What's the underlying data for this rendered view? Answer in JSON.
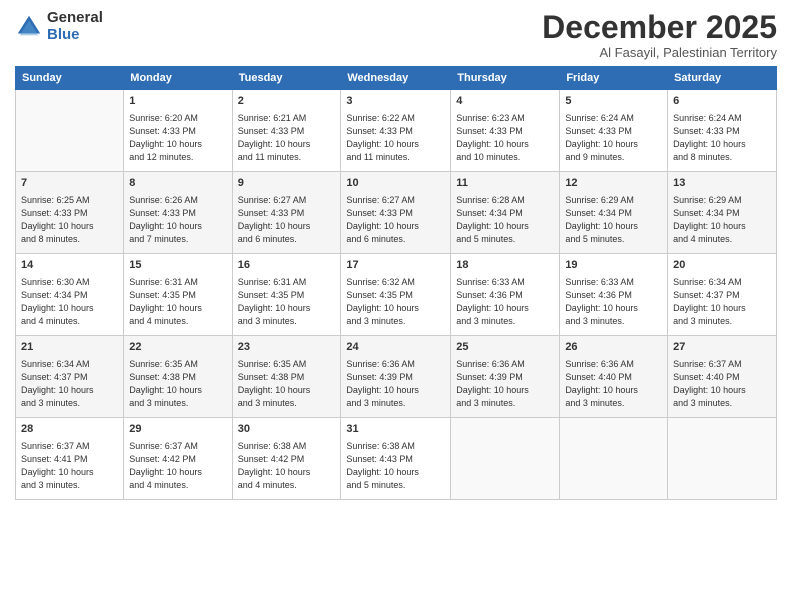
{
  "logo": {
    "general": "General",
    "blue": "Blue"
  },
  "header": {
    "month": "December 2025",
    "location": "Al Fasayil, Palestinian Territory"
  },
  "weekdays": [
    "Sunday",
    "Monday",
    "Tuesday",
    "Wednesday",
    "Thursday",
    "Friday",
    "Saturday"
  ],
  "weeks": [
    [
      {
        "day": "",
        "info": ""
      },
      {
        "day": "1",
        "info": "Sunrise: 6:20 AM\nSunset: 4:33 PM\nDaylight: 10 hours\nand 12 minutes."
      },
      {
        "day": "2",
        "info": "Sunrise: 6:21 AM\nSunset: 4:33 PM\nDaylight: 10 hours\nand 11 minutes."
      },
      {
        "day": "3",
        "info": "Sunrise: 6:22 AM\nSunset: 4:33 PM\nDaylight: 10 hours\nand 11 minutes."
      },
      {
        "day": "4",
        "info": "Sunrise: 6:23 AM\nSunset: 4:33 PM\nDaylight: 10 hours\nand 10 minutes."
      },
      {
        "day": "5",
        "info": "Sunrise: 6:24 AM\nSunset: 4:33 PM\nDaylight: 10 hours\nand 9 minutes."
      },
      {
        "day": "6",
        "info": "Sunrise: 6:24 AM\nSunset: 4:33 PM\nDaylight: 10 hours\nand 8 minutes."
      }
    ],
    [
      {
        "day": "7",
        "info": "Sunrise: 6:25 AM\nSunset: 4:33 PM\nDaylight: 10 hours\nand 8 minutes."
      },
      {
        "day": "8",
        "info": "Sunrise: 6:26 AM\nSunset: 4:33 PM\nDaylight: 10 hours\nand 7 minutes."
      },
      {
        "day": "9",
        "info": "Sunrise: 6:27 AM\nSunset: 4:33 PM\nDaylight: 10 hours\nand 6 minutes."
      },
      {
        "day": "10",
        "info": "Sunrise: 6:27 AM\nSunset: 4:33 PM\nDaylight: 10 hours\nand 6 minutes."
      },
      {
        "day": "11",
        "info": "Sunrise: 6:28 AM\nSunset: 4:34 PM\nDaylight: 10 hours\nand 5 minutes."
      },
      {
        "day": "12",
        "info": "Sunrise: 6:29 AM\nSunset: 4:34 PM\nDaylight: 10 hours\nand 5 minutes."
      },
      {
        "day": "13",
        "info": "Sunrise: 6:29 AM\nSunset: 4:34 PM\nDaylight: 10 hours\nand 4 minutes."
      }
    ],
    [
      {
        "day": "14",
        "info": "Sunrise: 6:30 AM\nSunset: 4:34 PM\nDaylight: 10 hours\nand 4 minutes."
      },
      {
        "day": "15",
        "info": "Sunrise: 6:31 AM\nSunset: 4:35 PM\nDaylight: 10 hours\nand 4 minutes."
      },
      {
        "day": "16",
        "info": "Sunrise: 6:31 AM\nSunset: 4:35 PM\nDaylight: 10 hours\nand 3 minutes."
      },
      {
        "day": "17",
        "info": "Sunrise: 6:32 AM\nSunset: 4:35 PM\nDaylight: 10 hours\nand 3 minutes."
      },
      {
        "day": "18",
        "info": "Sunrise: 6:33 AM\nSunset: 4:36 PM\nDaylight: 10 hours\nand 3 minutes."
      },
      {
        "day": "19",
        "info": "Sunrise: 6:33 AM\nSunset: 4:36 PM\nDaylight: 10 hours\nand 3 minutes."
      },
      {
        "day": "20",
        "info": "Sunrise: 6:34 AM\nSunset: 4:37 PM\nDaylight: 10 hours\nand 3 minutes."
      }
    ],
    [
      {
        "day": "21",
        "info": "Sunrise: 6:34 AM\nSunset: 4:37 PM\nDaylight: 10 hours\nand 3 minutes."
      },
      {
        "day": "22",
        "info": "Sunrise: 6:35 AM\nSunset: 4:38 PM\nDaylight: 10 hours\nand 3 minutes."
      },
      {
        "day": "23",
        "info": "Sunrise: 6:35 AM\nSunset: 4:38 PM\nDaylight: 10 hours\nand 3 minutes."
      },
      {
        "day": "24",
        "info": "Sunrise: 6:36 AM\nSunset: 4:39 PM\nDaylight: 10 hours\nand 3 minutes."
      },
      {
        "day": "25",
        "info": "Sunrise: 6:36 AM\nSunset: 4:39 PM\nDaylight: 10 hours\nand 3 minutes."
      },
      {
        "day": "26",
        "info": "Sunrise: 6:36 AM\nSunset: 4:40 PM\nDaylight: 10 hours\nand 3 minutes."
      },
      {
        "day": "27",
        "info": "Sunrise: 6:37 AM\nSunset: 4:40 PM\nDaylight: 10 hours\nand 3 minutes."
      }
    ],
    [
      {
        "day": "28",
        "info": "Sunrise: 6:37 AM\nSunset: 4:41 PM\nDaylight: 10 hours\nand 3 minutes."
      },
      {
        "day": "29",
        "info": "Sunrise: 6:37 AM\nSunset: 4:42 PM\nDaylight: 10 hours\nand 4 minutes."
      },
      {
        "day": "30",
        "info": "Sunrise: 6:38 AM\nSunset: 4:42 PM\nDaylight: 10 hours\nand 4 minutes."
      },
      {
        "day": "31",
        "info": "Sunrise: 6:38 AM\nSunset: 4:43 PM\nDaylight: 10 hours\nand 5 minutes."
      },
      {
        "day": "",
        "info": ""
      },
      {
        "day": "",
        "info": ""
      },
      {
        "day": "",
        "info": ""
      }
    ]
  ]
}
